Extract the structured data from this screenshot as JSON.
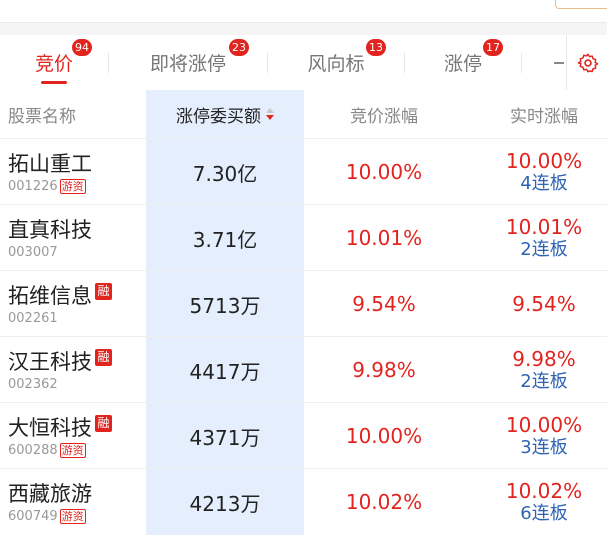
{
  "tabs": [
    {
      "label": "竞价",
      "badge": "94",
      "active": true
    },
    {
      "label": "即将涨停",
      "badge": "23",
      "active": false
    },
    {
      "label": "风向标",
      "badge": "13",
      "active": false
    },
    {
      "label": "涨停",
      "badge": "17",
      "active": false
    },
    {
      "label": "",
      "badge": "",
      "active": false
    }
  ],
  "header": {
    "col_name": "股票名称",
    "col_amount": "涨停委买额",
    "col_bid": "竞价涨幅",
    "col_realtime": "实时涨幅"
  },
  "rows": [
    {
      "name": "拓山重工",
      "code": "001226",
      "tag": "游资",
      "amount": "7.30亿",
      "bid": "10.00%",
      "realtime": "10.00%",
      "boards": "4连板"
    },
    {
      "name": "直真科技",
      "code": "003007",
      "tag": "",
      "amount": "3.71亿",
      "bid": "10.01%",
      "realtime": "10.01%",
      "boards": "2连板"
    },
    {
      "name": "拓维信息",
      "code": "002261",
      "tag": "融",
      "amount": "5713万",
      "bid": "9.54%",
      "realtime": "9.54%",
      "boards": ""
    },
    {
      "name": "汉王科技",
      "code": "002362",
      "tag": "融",
      "amount": "4417万",
      "bid": "9.98%",
      "realtime": "9.98%",
      "boards": "2连板"
    },
    {
      "name": "大恒科技",
      "code": "600288",
      "tag": "融",
      "tag2": "游资",
      "amount": "4371万",
      "bid": "10.00%",
      "realtime": "10.00%",
      "boards": "3连板"
    },
    {
      "name": "西藏旅游",
      "code": "600749",
      "tag": "游资",
      "amount": "4213万",
      "bid": "10.02%",
      "realtime": "10.02%",
      "boards": "6连板"
    }
  ],
  "colors": {
    "accent": "#e2241f",
    "board_blue": "#2f64b5",
    "highlight": "#e4eefc"
  }
}
